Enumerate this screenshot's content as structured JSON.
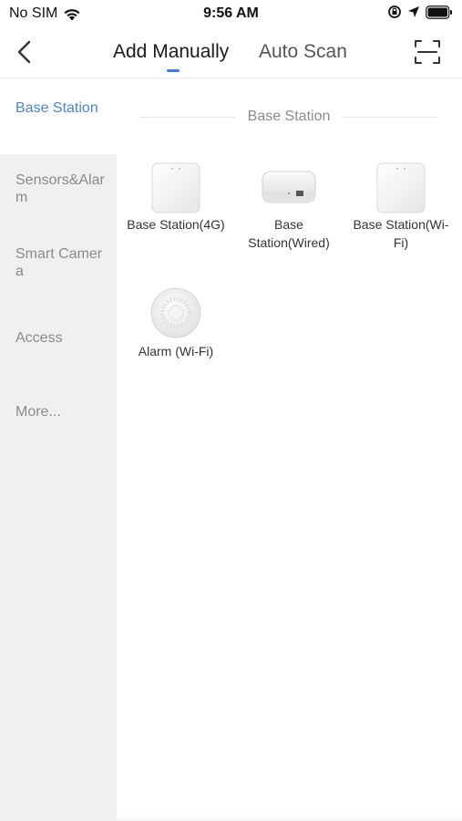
{
  "status_bar": {
    "carrier": "No SIM",
    "time": "9:56 AM",
    "icons": [
      "wifi-icon",
      "rotation-lock-icon",
      "location-arrow-icon",
      "battery-icon"
    ]
  },
  "nav": {
    "back_icon": "chevron-left-icon",
    "tabs": [
      {
        "label": "Add Manually",
        "active": true
      },
      {
        "label": "Auto Scan",
        "active": false
      }
    ],
    "scan_icon": "scan-frame-icon",
    "accent": "#3b7bdc"
  },
  "sidebar": {
    "items": [
      {
        "label": "Base Station",
        "active": true
      },
      {
        "label": "Sensors&Alarm",
        "active": false
      },
      {
        "label": "Smart Camera",
        "active": false
      },
      {
        "label": "Access",
        "active": false
      },
      {
        "label": "More...",
        "active": false
      }
    ],
    "active_color": "#4a86c8"
  },
  "section": {
    "title": "Base Station"
  },
  "devices": [
    {
      "label": "Base Station(4G)",
      "icon": "base-station-4g-icon"
    },
    {
      "label": "Base Station(Wired)",
      "icon": "base-station-wired-icon"
    },
    {
      "label": "Base Station(Wi-Fi)",
      "icon": "base-station-wifi-icon"
    },
    {
      "label": "Alarm (Wi-Fi)",
      "icon": "alarm-wifi-icon"
    }
  ]
}
